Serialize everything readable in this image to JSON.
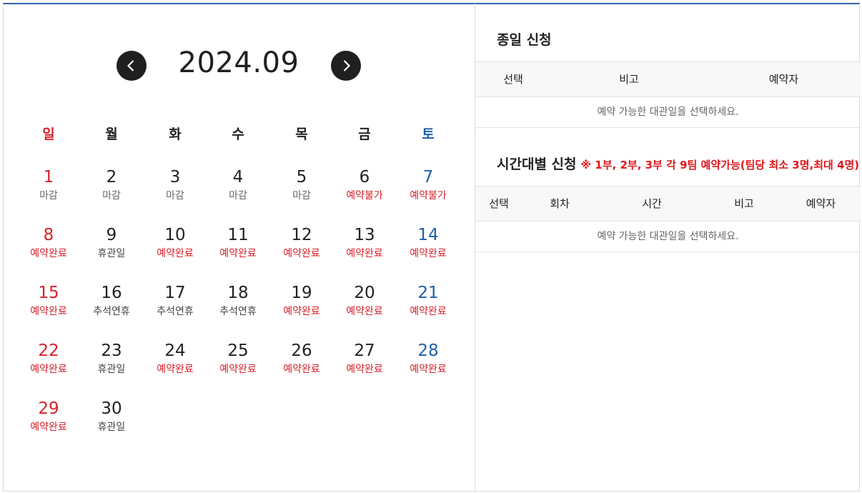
{
  "calendar": {
    "month_label": "2024.09",
    "weekdays": [
      "일",
      "월",
      "화",
      "수",
      "목",
      "금",
      "토"
    ],
    "days": [
      {
        "day": "1",
        "status": "마감",
        "tone": "grey"
      },
      {
        "day": "2",
        "status": "마감",
        "tone": "grey"
      },
      {
        "day": "3",
        "status": "마감",
        "tone": "grey"
      },
      {
        "day": "4",
        "status": "마감",
        "tone": "grey"
      },
      {
        "day": "5",
        "status": "마감",
        "tone": "grey"
      },
      {
        "day": "6",
        "status": "예약불가",
        "tone": "red"
      },
      {
        "day": "7",
        "status": "예약불가",
        "tone": "red"
      },
      {
        "day": "8",
        "status": "예약완료",
        "tone": "red"
      },
      {
        "day": "9",
        "status": "휴관일",
        "tone": "dark"
      },
      {
        "day": "10",
        "status": "예약완료",
        "tone": "red"
      },
      {
        "day": "11",
        "status": "예약완료",
        "tone": "red"
      },
      {
        "day": "12",
        "status": "예약완료",
        "tone": "red"
      },
      {
        "day": "13",
        "status": "예약완료",
        "tone": "red"
      },
      {
        "day": "14",
        "status": "예약완료",
        "tone": "red"
      },
      {
        "day": "15",
        "status": "예약완료",
        "tone": "red"
      },
      {
        "day": "16",
        "status": "추석연휴",
        "tone": "dark"
      },
      {
        "day": "17",
        "status": "추석연휴",
        "tone": "dark"
      },
      {
        "day": "18",
        "status": "추석연휴",
        "tone": "dark"
      },
      {
        "day": "19",
        "status": "예약완료",
        "tone": "red"
      },
      {
        "day": "20",
        "status": "예약완료",
        "tone": "red"
      },
      {
        "day": "21",
        "status": "예약완료",
        "tone": "red"
      },
      {
        "day": "22",
        "status": "예약완료",
        "tone": "red"
      },
      {
        "day": "23",
        "status": "휴관일",
        "tone": "dark"
      },
      {
        "day": "24",
        "status": "예약완료",
        "tone": "red"
      },
      {
        "day": "25",
        "status": "예약완료",
        "tone": "red"
      },
      {
        "day": "26",
        "status": "예약완료",
        "tone": "red"
      },
      {
        "day": "27",
        "status": "예약완료",
        "tone": "red"
      },
      {
        "day": "28",
        "status": "예약완료",
        "tone": "red"
      },
      {
        "day": "29",
        "status": "예약완료",
        "tone": "red"
      },
      {
        "day": "30",
        "status": "휴관일",
        "tone": "dark"
      }
    ],
    "prev_icon": "chevron-left-icon",
    "next_icon": "chevron-right-icon"
  },
  "full_day": {
    "title": "종일 신청",
    "columns": [
      "선택",
      "비고",
      "예약자"
    ],
    "empty_message": "예약 가능한 대관일을 선택하세요."
  },
  "time_slot": {
    "title": "시간대별 신청",
    "note": "※ 1부, 2부, 3부 각 9팀 예약가능(팀당 최소 3명,최대 4명)",
    "columns": [
      "선택",
      "회차",
      "시간",
      "비고",
      "예약자"
    ],
    "empty_message": "예약 가능한 대관일을 선택하세요."
  },
  "colors": {
    "accent_blue": "#2f63ad",
    "sunday_red": "#d6202a",
    "saturday_blue": "#1f5fa8",
    "status_red": "#d6202a",
    "note_red": "#e0161c"
  }
}
